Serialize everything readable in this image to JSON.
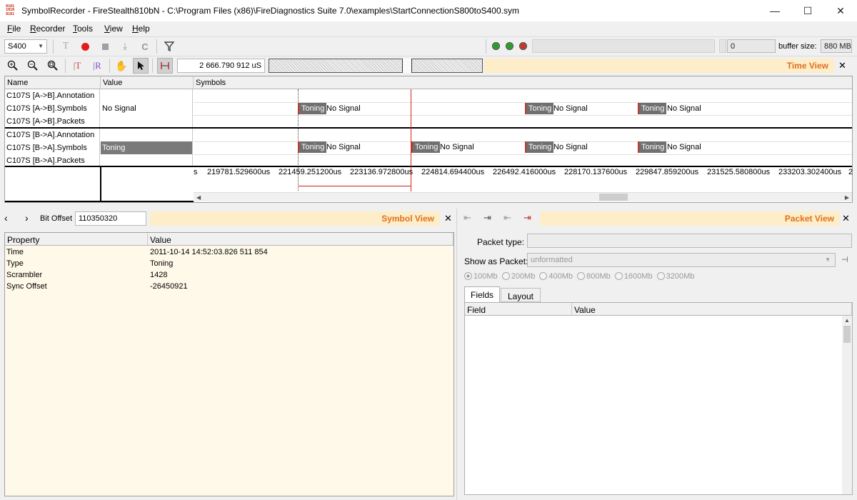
{
  "window": {
    "title": "SymbolRecorder - FireStealth810bN  - C:\\Program Files (x86)\\FireDiagnostics Suite 7.0\\examples\\StartConnectionS800toS400.sym",
    "icon_text": "0101\n1010\n0101",
    "minimize": "—",
    "maximize": "☐",
    "close": "✕"
  },
  "menu": [
    {
      "label": "File",
      "ul": "F",
      "rest": "ile"
    },
    {
      "label": "Recorder",
      "ul": "R",
      "rest": "ecorder"
    },
    {
      "label": "Tools",
      "ul": "T",
      "rest": "ools"
    },
    {
      "label": "View",
      "ul": "V",
      "rest": "iew"
    },
    {
      "label": "Help",
      "ul": "H",
      "rest": "elp"
    }
  ],
  "toolbar": {
    "speed_select": "S400",
    "status_led_colors": [
      "#2e9b2e",
      "#2e9b2e",
      "#c0392b"
    ],
    "counter_value": "0",
    "buffer_label": "buffer size:",
    "buffer_value": "880 MB"
  },
  "timebar": {
    "time_value": "2 666.790 912 uS",
    "view_title": "Time View",
    "close": "✕"
  },
  "grid": {
    "headers": {
      "name": "Name",
      "value": "Value",
      "symbols": "Symbols"
    },
    "rows": [
      {
        "name": "C107S [A->B].Annotation",
        "value": ""
      },
      {
        "name": "C107S [A->B].Symbols",
        "value": "No Signal"
      },
      {
        "name": "C107S [A->B].Packets",
        "value": ""
      },
      {
        "name": "C107S [B->A].Annotation",
        "value": ""
      },
      {
        "name": "C107S [B->A].Symbols",
        "value": "Toning"
      },
      {
        "name": "C107S [B->A].Packets",
        "value": ""
      }
    ],
    "symbols_ab": [
      {
        "type": "Toning",
        "label": "No Signal"
      },
      {
        "type": "Toning",
        "label": "No Signal"
      },
      {
        "type": "Toning",
        "label": "No Signal"
      }
    ],
    "symbols_ba": [
      {
        "type": "Toning",
        "label": "No Signal"
      },
      {
        "type": "Toning",
        "label": "No Signal"
      },
      {
        "type": "Toning",
        "label": "No Signal"
      },
      {
        "type": "Toning",
        "label": "No Signal"
      }
    ],
    "ticks": [
      "s",
      "219781.529600us",
      "221459.251200us",
      "223136.972800us",
      "224814.694400us",
      "226492.416000us",
      "228170.137600us",
      "229847.859200us",
      "231525.580800us",
      "233203.302400us",
      "2"
    ]
  },
  "symbol_nav": {
    "prev": "‹",
    "next": "›",
    "bit_offset_label": "Bit Offset",
    "bit_offset_value": "110350320",
    "view_title": "Symbol View",
    "close": "✕"
  },
  "symbol_table": {
    "headers": {
      "property": "Property",
      "value": "Value"
    },
    "rows": [
      {
        "property": "Time",
        "value": "2011-10-14  14:52:03.826 511 854"
      },
      {
        "property": "Type",
        "value": "Toning"
      },
      {
        "property": "Scrambler",
        "value": "1428"
      },
      {
        "property": "Sync Offset",
        "value": "-26450921"
      }
    ]
  },
  "packet_view": {
    "view_title": "Packet View",
    "close": "✕",
    "packet_type_label": "Packet type:",
    "packet_type_value": "",
    "show_as_label": "Show as Packet:",
    "show_as_value": "unformatted",
    "speeds": [
      "100Mb",
      "200Mb",
      "400Mb",
      "800Mb",
      "1600Mb",
      "3200Mb"
    ],
    "tabs": [
      "Fields",
      "Layout"
    ],
    "table_headers": {
      "field": "Field",
      "value": "Value"
    }
  }
}
